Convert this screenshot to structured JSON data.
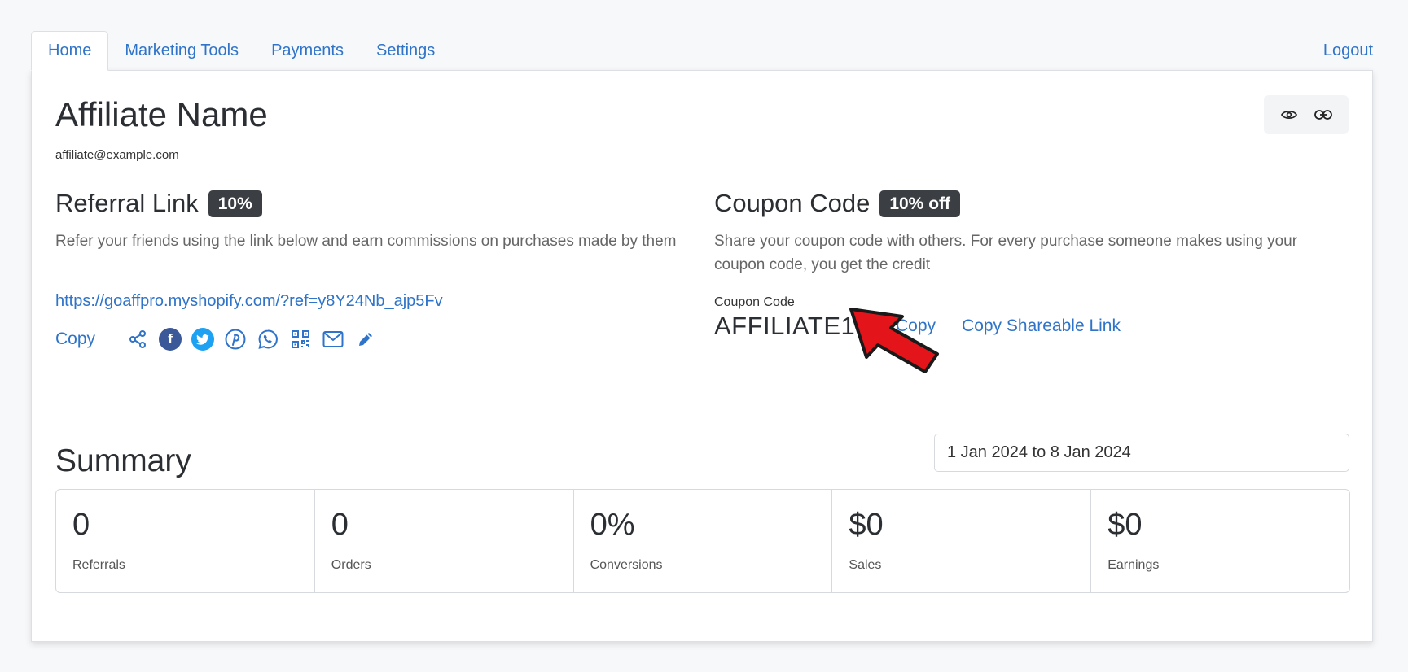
{
  "nav": {
    "tabs": [
      {
        "label": "Home"
      },
      {
        "label": "Marketing Tools"
      },
      {
        "label": "Payments"
      },
      {
        "label": "Settings"
      }
    ],
    "logout": "Logout"
  },
  "profile": {
    "name": "Affiliate Name",
    "email": "affiliate@example.com"
  },
  "referral": {
    "title": "Referral Link",
    "badge": "10%",
    "description": "Refer your friends using the link below and earn commissions on purchases made by them",
    "link": "https://goaffpro.myshopify.com/?ref=y8Y24Nb_ajp5Fv",
    "copy_label": "Copy",
    "share_icons": [
      "share-icon",
      "facebook-icon",
      "twitter-icon",
      "pinterest-icon",
      "whatsapp-icon",
      "qr-code-icon",
      "email-icon",
      "edit-icon"
    ]
  },
  "coupon": {
    "title": "Coupon Code",
    "badge": "10% off",
    "description": "Share your coupon code with others. For every purchase someone makes using your coupon code, you get the credit",
    "label": "Coupon Code",
    "code": "AFFILIATE10",
    "copy_label": "Copy",
    "copy_shareable_label": "Copy Shareable Link"
  },
  "summary": {
    "title": "Summary",
    "date_range": "1 Jan 2024 to 8 Jan 2024",
    "stats": [
      {
        "value": "0",
        "label": "Referrals"
      },
      {
        "value": "0",
        "label": "Orders"
      },
      {
        "value": "0%",
        "label": "Conversions"
      },
      {
        "value": "$0",
        "label": "Sales"
      },
      {
        "value": "$0",
        "label": "Earnings"
      }
    ]
  },
  "colors": {
    "link": "#2f74c9",
    "badge_bg": "#3b3f44",
    "arrow": "#e3151a",
    "facebook": "#3b5998",
    "twitter": "#1da1f2"
  }
}
